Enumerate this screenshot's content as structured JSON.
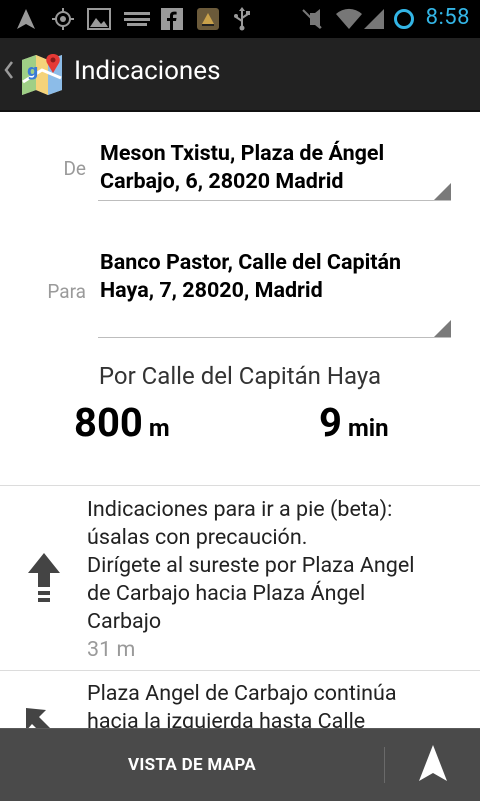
{
  "status_bar": {
    "time": "8:58",
    "icons": [
      "navigation-arrow-icon",
      "gps-icon",
      "image-icon",
      "text-notification-icon",
      "facebook-icon",
      "app-notification-icon",
      "usb-icon",
      "mute-icon",
      "wifi-icon",
      "signal-icon",
      "battery-icon"
    ],
    "accent_color": "#33b5e5"
  },
  "action_bar": {
    "title": "Indicaciones",
    "app_icon": "google-maps-icon"
  },
  "from": {
    "label": "De",
    "value": "Meson Txistu, Plaza de Ángel Carbajo, 6, 28020 Madrid"
  },
  "to": {
    "label": "Para",
    "value": "Banco Pastor, Calle del Capitán Haya, 7, 28020, Madrid"
  },
  "summary": {
    "route_name": "Por Calle del Capitán Haya",
    "distance_value": "800",
    "distance_unit": "m",
    "time_value": "9",
    "time_unit": "min"
  },
  "steps": [
    {
      "icon": "straight-arrow-icon",
      "line1": "Indicaciones para ir a pie (beta):",
      "line2": "úsalas con precaución.",
      "line3": "Dirígete al sureste por Plaza Angel",
      "line4": "de Carbajo hacia Plaza Ángel",
      "line5": "Carbajo",
      "distance": "31 m"
    },
    {
      "icon": "turn-left-arrow-icon",
      "line1": "Plaza Angel de Carbajo continúa",
      "line2": "hacia la izquierda hasta Calle"
    }
  ],
  "bottom_bar": {
    "map_view_label": "VISTA DE MAPA",
    "nav_icon": "navigation-arrow-icon"
  }
}
